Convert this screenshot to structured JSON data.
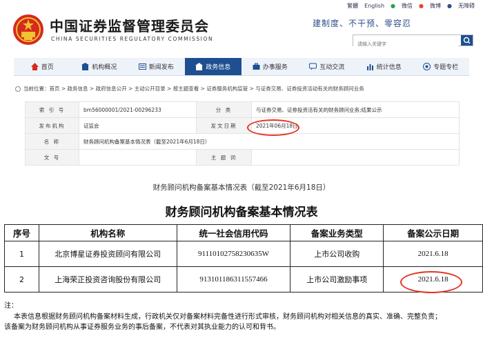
{
  "header": {
    "org_cn": "中国证券监督管理委员会",
    "org_en": "CHINA SECURITIES REGULATORY COMMISSION",
    "util": [
      "繁體",
      "English",
      "微信",
      "微博",
      "无障碍"
    ],
    "slogan": "建制度、不干预、零容忍",
    "search_placeholder": "请输入关键字"
  },
  "nav": [
    "首页",
    "机构概况",
    "新闻发布",
    "政务信息",
    "办事服务",
    "互动交流",
    "统计信息",
    "专题专栏"
  ],
  "breadcrumb": "当前位置：首页 > 政务信息 > 政府信息公开 > 主动公开目录 > 按主题查看 > 证券服务机构监管 > 与证券交易、证券投资活动有关的财务顾问业务",
  "info": {
    "index_label": "索 引 号",
    "index_value": "bm56000001/2021-00296233",
    "category_label": "分 类",
    "category_value": "与证券交易、证券投资活有关的财务顾问业务;结果公示",
    "issuer_label": "发布机构",
    "issuer_value": "证监会",
    "date_label": "发文日期",
    "date_value": "2021年06月18日",
    "name_label": "名 称",
    "name_value": "财务顾问机构备案基本情况表（截至2021年6月18日）",
    "docno_label": "文 号",
    "docno_value": "",
    "subject_label": "主 题 词",
    "subject_value": ""
  },
  "doc_title": "财务顾问机构备案基本情况表（截至2021年6月18日）",
  "main": {
    "title": "财务顾问机构备案基本情况表",
    "headers": [
      "序号",
      "机构名称",
      "统一社会信用代码",
      "备案业务类型",
      "备案公示日期"
    ],
    "rows": [
      [
        "1",
        "北京博星证券投资顾问有限公司",
        "91110102758230635W",
        "上市公司收购",
        "2021.6.18"
      ],
      [
        "2",
        "上海荣正投资咨询股份有限公司",
        "913101186311557466",
        "上市公司激励事项",
        "2021.6.18"
      ]
    ]
  },
  "note": {
    "label": "注：",
    "line1": "本表信息根据财务顾问机构备案材料生成，行政机关仅对备案材料完备性进行形式审核，财务顾问机构对相关信息的真实、准确、完整负责；",
    "line2": "该备案为财务顾问机构从事证券服务业务的事后备案，不代表对其执业能力的认可和背书。"
  },
  "colors": {
    "brand_blue": "#1d4f91",
    "highlight_red": "#e53322"
  }
}
